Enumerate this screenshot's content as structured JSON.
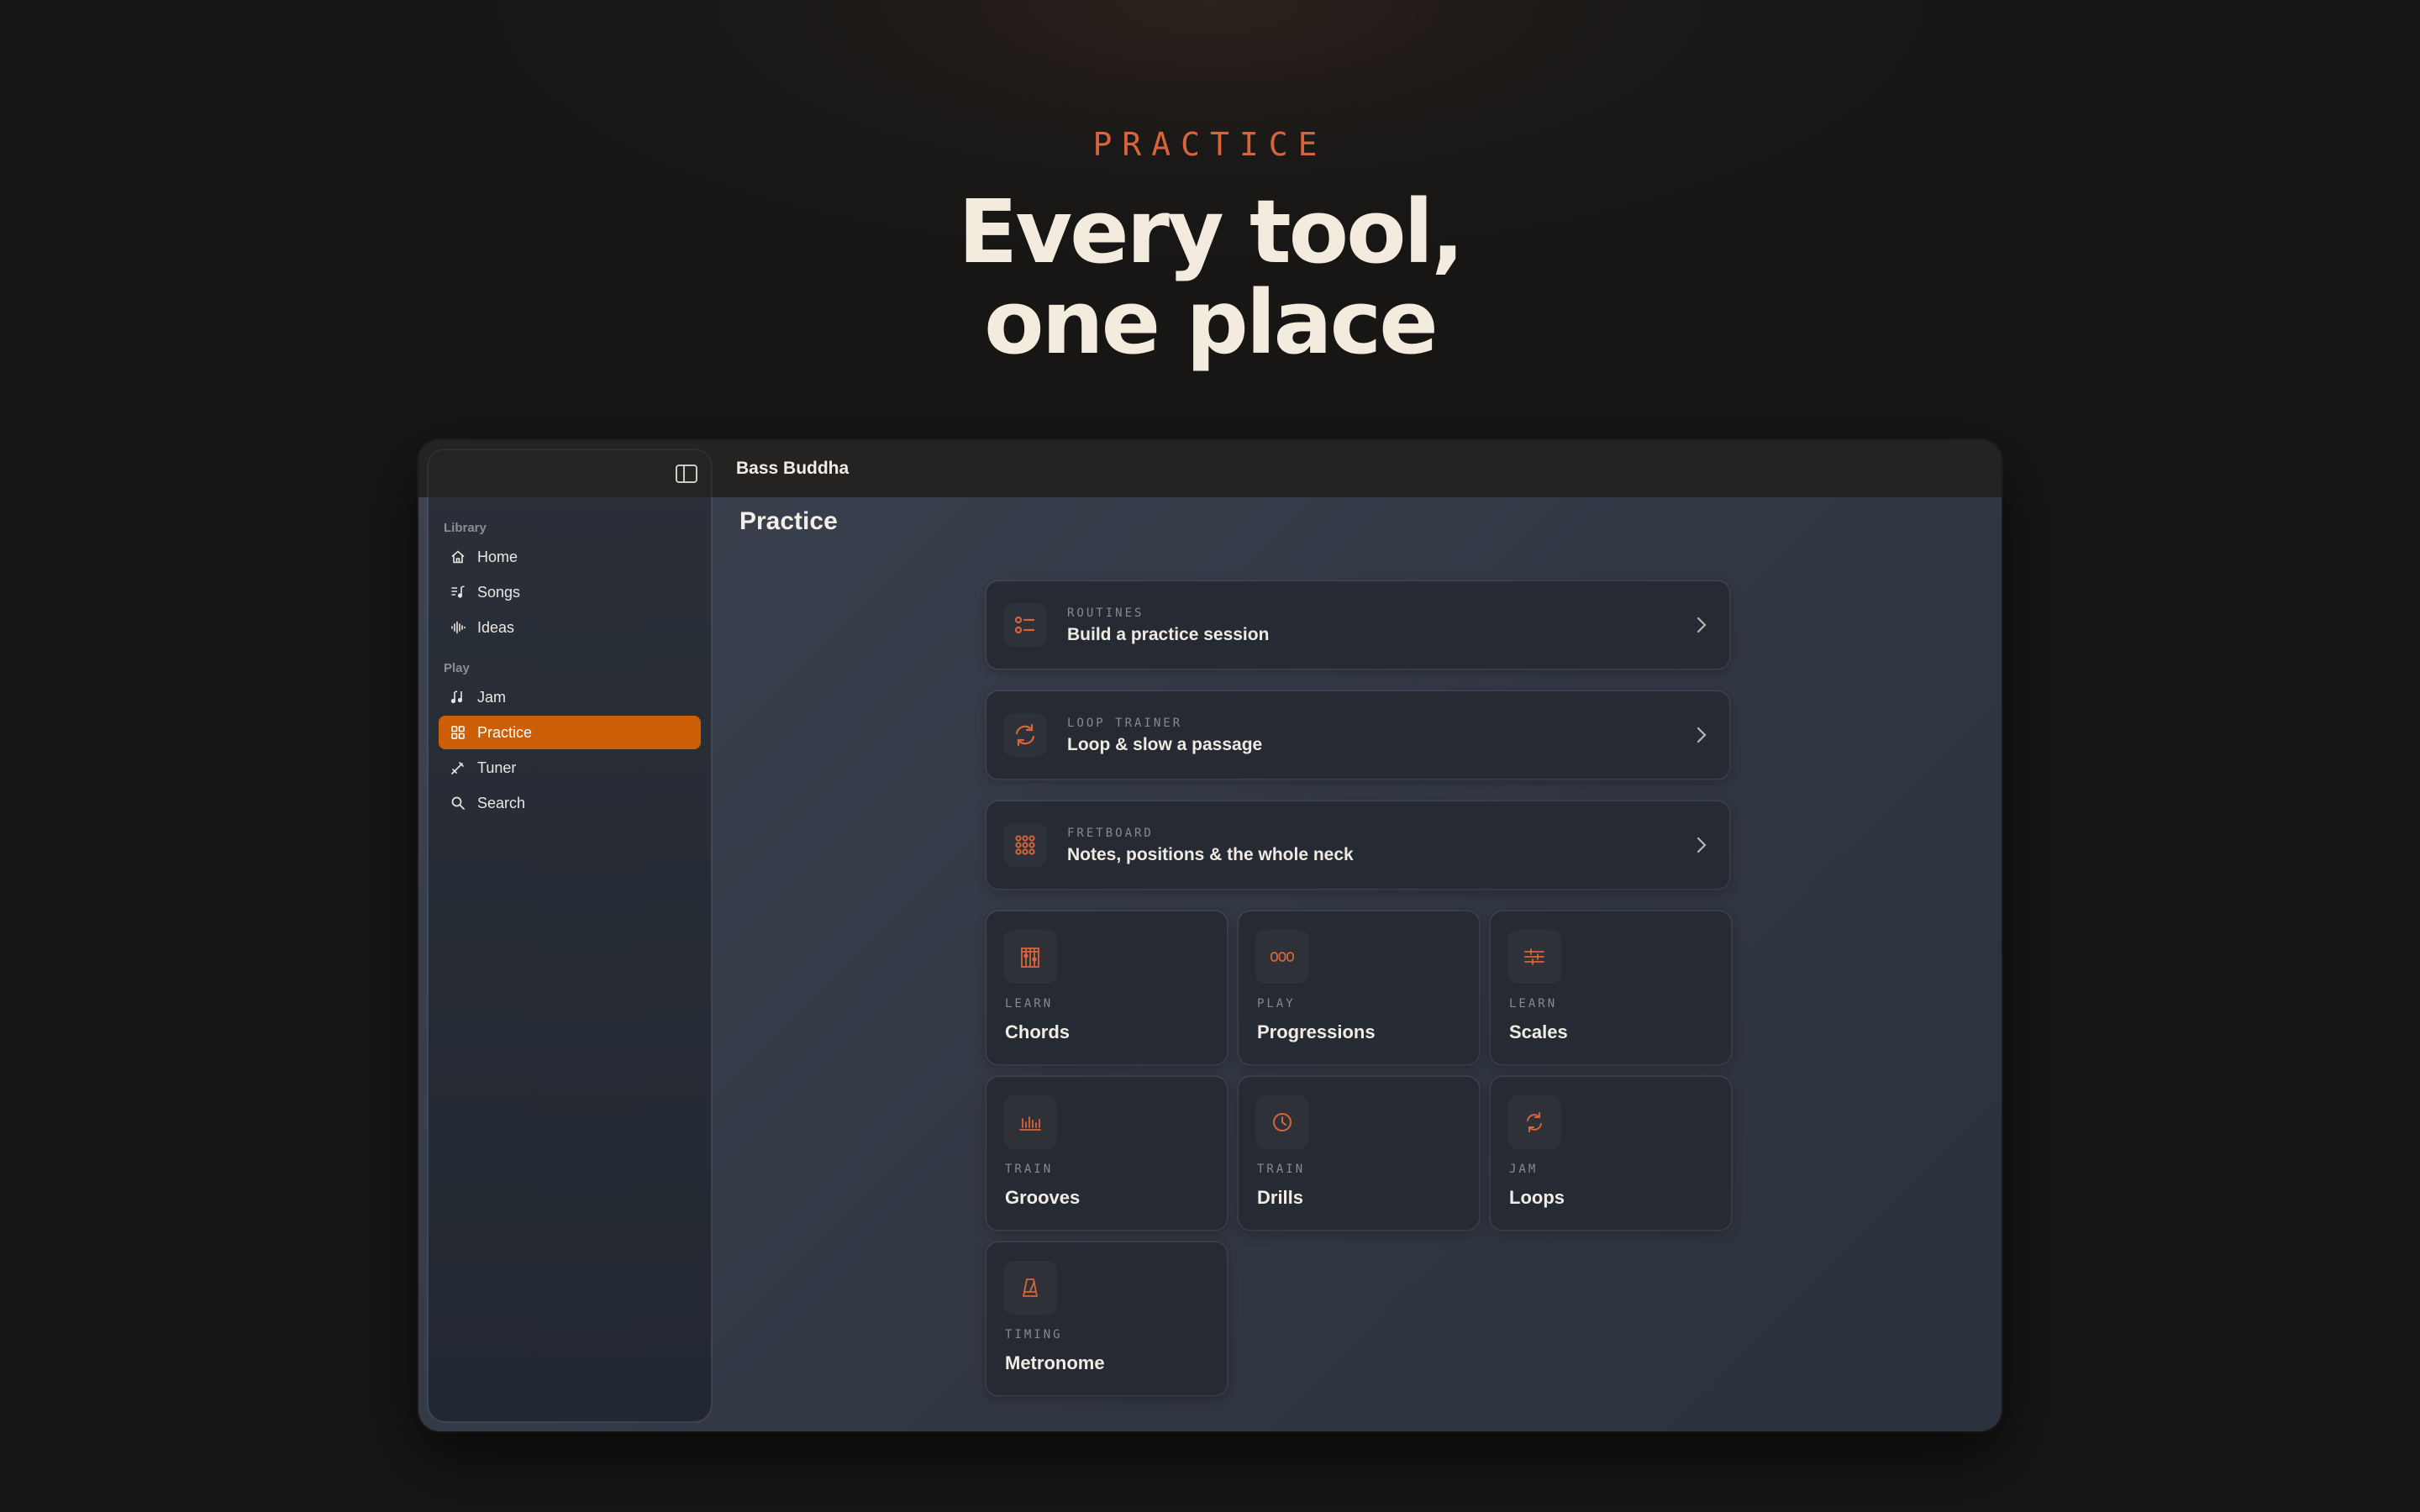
{
  "hero": {
    "eyebrow": "PRACTICE",
    "headline_line1": "Every tool,",
    "headline_line2": "one place"
  },
  "app": {
    "title": "Bass Buddha",
    "accent_color": "#cc5e06",
    "icon_color": "#d9643a"
  },
  "sidebar": {
    "toggle_icon": "sidebar-toggle-icon",
    "sections": [
      {
        "label": "Library",
        "items": [
          {
            "label": "Home",
            "icon": "home-icon"
          },
          {
            "label": "Songs",
            "icon": "songs-icon"
          },
          {
            "label": "Ideas",
            "icon": "waveform-icon"
          }
        ]
      },
      {
        "label": "Play",
        "items": [
          {
            "label": "Jam",
            "icon": "jam-icon"
          },
          {
            "label": "Practice",
            "icon": "grid-icon",
            "active": true
          },
          {
            "label": "Tuner",
            "icon": "tuner-icon"
          },
          {
            "label": "Search",
            "icon": "search-icon"
          }
        ]
      }
    ]
  },
  "main": {
    "page_title": "Practice",
    "wide_cards": [
      {
        "kicker": "ROUTINES",
        "title": "Build a practice session",
        "icon": "checklist-icon"
      },
      {
        "kicker": "LOOP TRAINER",
        "title": "Loop & slow a passage",
        "icon": "loop-icon"
      },
      {
        "kicker": "FRETBOARD",
        "title": "Notes, positions & the whole neck",
        "icon": "fretboard-grid-icon"
      }
    ],
    "tiles": [
      {
        "kicker": "LEARN",
        "title": "Chords",
        "icon": "chord-diagram-icon"
      },
      {
        "kicker": "PLAY",
        "title": "Progressions",
        "icon": "progression-icon"
      },
      {
        "kicker": "LEARN",
        "title": "Scales",
        "icon": "scales-icon"
      },
      {
        "kicker": "TRAIN",
        "title": "Grooves",
        "icon": "grooves-icon"
      },
      {
        "kicker": "TRAIN",
        "title": "Drills",
        "icon": "clock-icon"
      },
      {
        "kicker": "JAM",
        "title": "Loops",
        "icon": "loops-icon"
      },
      {
        "kicker": "TIMING",
        "title": "Metronome",
        "icon": "metronome-icon"
      }
    ]
  }
}
